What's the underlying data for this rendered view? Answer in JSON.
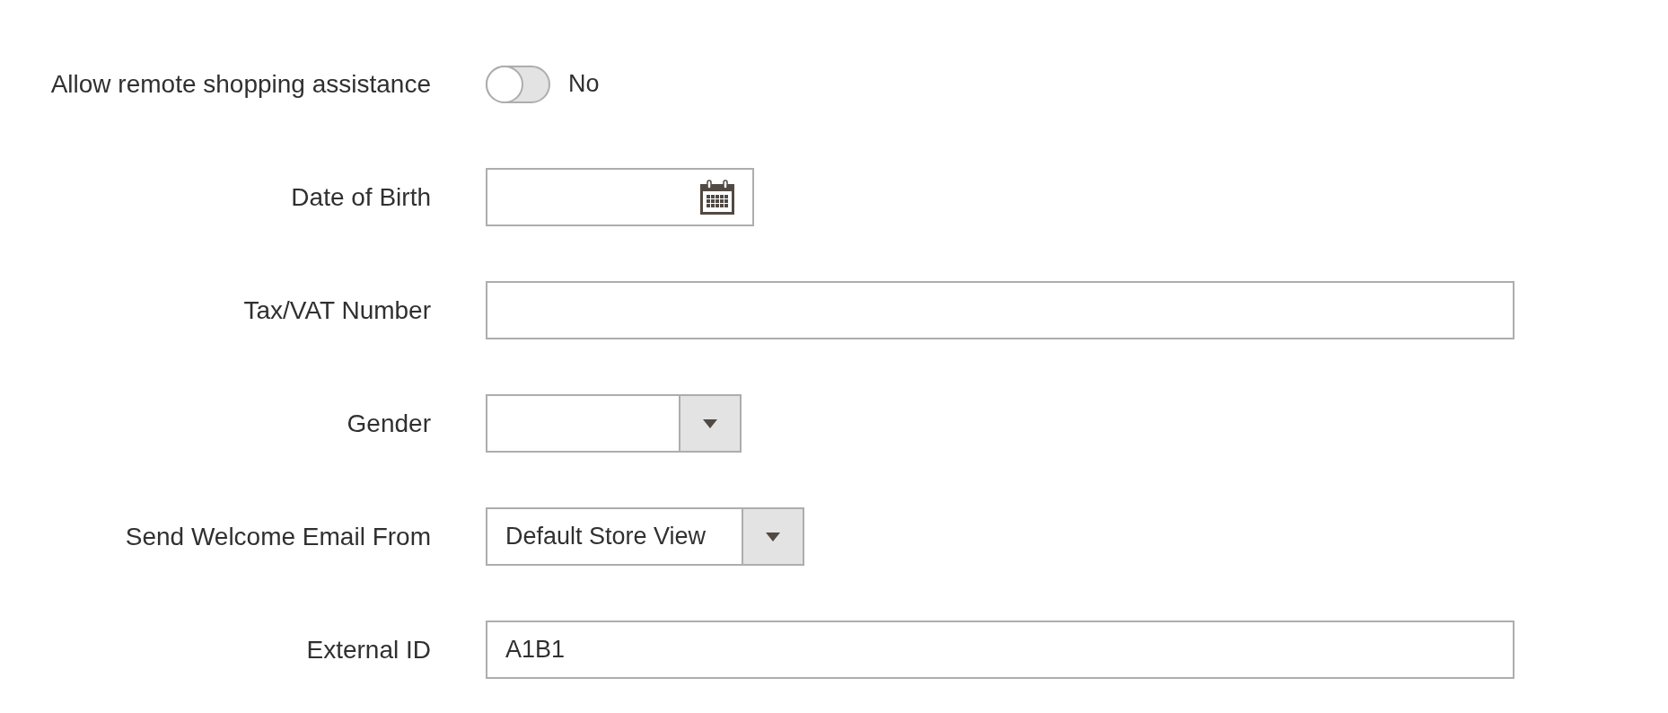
{
  "fields": [
    {
      "kind": "toggle",
      "label": "Allow remote shopping assistance",
      "on": false,
      "state_text": "No"
    },
    {
      "kind": "date",
      "label": "Date of Birth"
    },
    {
      "kind": "text",
      "label": "Tax/VAT Number"
    },
    {
      "kind": "select",
      "label": "Gender"
    },
    {
      "kind": "select",
      "label": "Send Welcome Email From",
      "value": "Default Store View"
    },
    {
      "kind": "text",
      "label": "External ID",
      "value": "A1B1"
    }
  ]
}
